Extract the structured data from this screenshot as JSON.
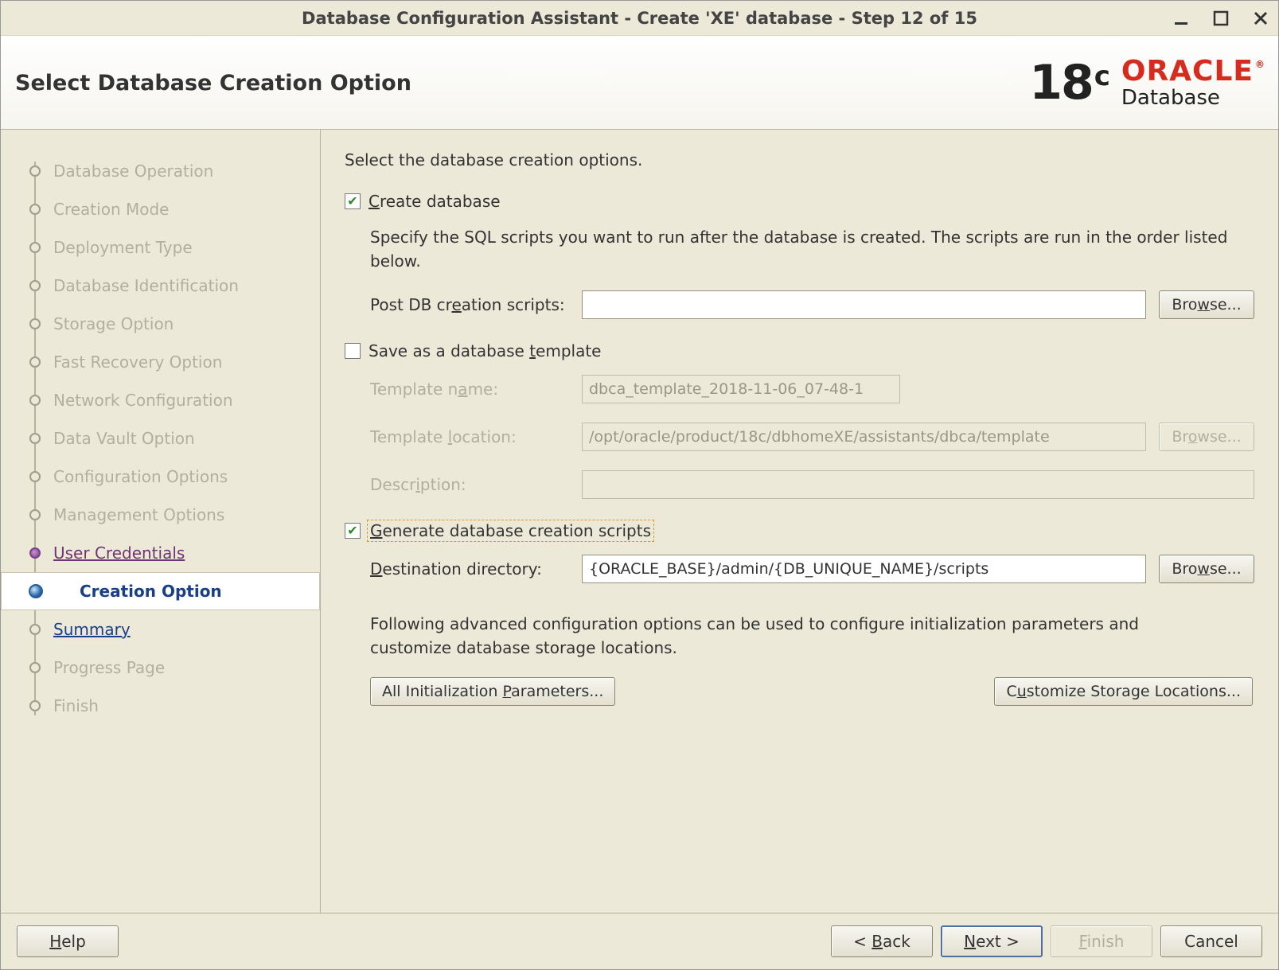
{
  "window": {
    "title": "Database Configuration Assistant - Create 'XE' database - Step 12 of 15"
  },
  "header": {
    "page_title": "Select Database Creation Option",
    "brand_number": "18",
    "brand_suffix": "c",
    "brand_oracle": "ORACLE",
    "brand_database": "Database"
  },
  "sidebar": {
    "steps": [
      {
        "label": "Database Operation",
        "state": "done"
      },
      {
        "label": "Creation Mode",
        "state": "done"
      },
      {
        "label": "Deployment Type",
        "state": "done"
      },
      {
        "label": "Database Identification",
        "state": "done"
      },
      {
        "label": "Storage Option",
        "state": "done"
      },
      {
        "label": "Fast Recovery Option",
        "state": "done"
      },
      {
        "label": "Network Configuration",
        "state": "done"
      },
      {
        "label": "Data Vault Option",
        "state": "done"
      },
      {
        "label": "Configuration Options",
        "state": "done"
      },
      {
        "label": "Management Options",
        "state": "done"
      },
      {
        "label": "User Credentials",
        "state": "previous"
      },
      {
        "label": "Creation Option",
        "state": "current"
      },
      {
        "label": "Summary",
        "state": "upcoming-link"
      },
      {
        "label": "Progress Page",
        "state": "upcoming"
      },
      {
        "label": "Finish",
        "state": "upcoming"
      }
    ]
  },
  "main": {
    "instruction": "Select the database creation options.",
    "create_db": {
      "checked": true,
      "mnemonic": "C",
      "label_rest": "reate database",
      "help": "Specify the SQL scripts you want to run after the database is created. The scripts are run in the order listed below.",
      "post_scripts_label": {
        "pre": "Post DB cr",
        "mn": "e",
        "post": "ation scripts:"
      },
      "post_scripts_value": "",
      "browse_label": {
        "pre": "Bro",
        "mn": "w",
        "post": "se..."
      }
    },
    "save_template": {
      "checked": false,
      "label": {
        "pre": "Save as a database ",
        "mn": "t",
        "post": "emplate"
      },
      "name_label": {
        "pre": "Template n",
        "mn": "a",
        "post": "me:"
      },
      "name_value": "dbca_template_2018-11-06_07-48-1",
      "loc_label": {
        "pre": "Template ",
        "mn": "l",
        "post": "ocation:"
      },
      "loc_value": "/opt/oracle/product/18c/dbhomeXE/assistants/dbca/template",
      "desc_label": {
        "pre": "Descr",
        "mn": "i",
        "post": "ption:"
      },
      "desc_value": "",
      "browse_label": {
        "pre": "Br",
        "mn": "o",
        "post": "wse..."
      }
    },
    "gen_scripts": {
      "checked": true,
      "label": {
        "mn": "G",
        "post": "enerate database creation scripts"
      },
      "dest_label": {
        "mn": "D",
        "post": "estination directory:"
      },
      "dest_value": "{ORACLE_BASE}/admin/{DB_UNIQUE_NAME}/scripts",
      "browse_label": {
        "pre": "Bro",
        "mn": "w",
        "post": "se..."
      }
    },
    "advanced": {
      "text": "Following advanced configuration options can be used to configure initialization parameters and customize database storage locations.",
      "all_params": {
        "pre": "All Initialization ",
        "mn": "P",
        "post": "arameters..."
      },
      "cust_storage": {
        "pre": "C",
        "mn": "u",
        "post": "stomize Storage Locations..."
      }
    }
  },
  "footer": {
    "help": {
      "mn": "H",
      "post": "elp"
    },
    "back": {
      "pre": "< ",
      "mn": "B",
      "post": "ack"
    },
    "next": {
      "mn": "N",
      "post": "ext >"
    },
    "finish": {
      "mn": "F",
      "post": "inish"
    },
    "cancel": "Cancel"
  }
}
